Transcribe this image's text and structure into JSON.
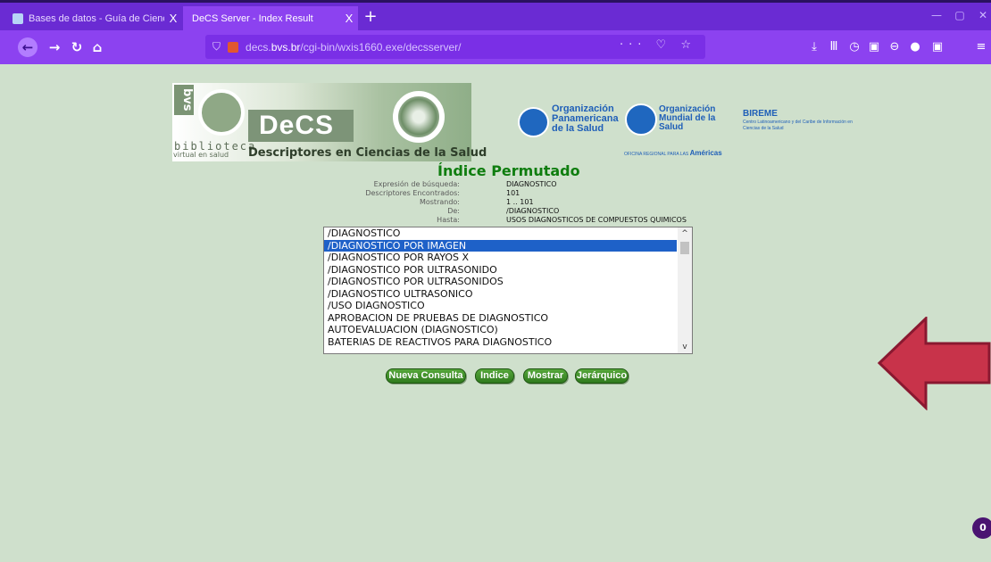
{
  "browser": {
    "tabs": [
      {
        "title": "Bases de datos - Guía de Cienc",
        "close": "X",
        "icon": "database-favicon-icon"
      },
      {
        "title": "DeCS Server - Index Result",
        "close": "X"
      }
    ],
    "new_tab": "+",
    "url_shield": "⛉",
    "url_host_pre": "decs.",
    "url_host_bold": "bvs.br",
    "url_path": "/cgi-bin/wxis1660.exe/decsserver/",
    "url_actions": "··· ♡ ☆",
    "icons": [
      "back-icon",
      "forward-icon",
      "reload-icon",
      "home-icon",
      "download-icon",
      "library-icon",
      "history-icon",
      "sidebar-icon",
      "account-icon",
      "notification-icon",
      "pocket-icon",
      "menu-icon"
    ],
    "colors": {
      "tabbar": "#6a2bd3",
      "toolbar": "#8c42f0"
    }
  },
  "header": {
    "bvs": "bvs",
    "decs": "DeCS",
    "biblioteca": "biblioteca",
    "virtual": "virtual en salud",
    "descriptores": "Descriptores en Ciencias de la Salud",
    "opas": "Organización Panamericana de la Salud",
    "oms": "Organización Mundial de la Salud",
    "oms_sub_small": "OFICINA REGIONAL PARA LAS",
    "oms_sub_big": "Américas",
    "bireme_title": "BIREME",
    "bireme_sub": "Centro Latinoamericano y del Caribe de Información en Ciencias de la Salud"
  },
  "index": {
    "title": "Índice Permutado",
    "rows": [
      {
        "key": "Expresión de búsqueda:",
        "value": "DIAGNOSTICO"
      },
      {
        "key": "Descriptores Encontrados:",
        "value": "101"
      },
      {
        "key": "Mostrando:",
        "value": "1 .. 101"
      },
      {
        "key": "De:",
        "value": "/DIAGNOSTICO"
      },
      {
        "key": "Hasta:",
        "value": "USOS DIAGNOSTICOS DE COMPUESTOS QUIMICOS"
      }
    ]
  },
  "list": {
    "items": [
      "/DIAGNOSTICO",
      "/DIAGNOSTICO POR IMAGEN",
      "/DIAGNOSTICO POR RAYOS X",
      "/DIAGNOSTICO POR ULTRASONIDO",
      "/DIAGNOSTICO POR ULTRASONIDOS",
      "/DIAGNOSTICO ULTRASONICO",
      "/USO DIAGNOSTICO",
      "APROBACION DE PRUEBAS DE DIAGNOSTICO",
      "AUTOEVALUACION (DIAGNOSTICO)",
      "BATERIAS DE REACTIVOS PARA DIAGNOSTICO"
    ],
    "selected_index": 1,
    "scroll_up": "^",
    "scroll_down": "v"
  },
  "buttons": {
    "nueva": "Nueva Consulta",
    "indice": "Indice",
    "mostrar": "Mostrar",
    "jerarquico": "Jerárquico"
  },
  "annotation": {
    "arrow_color": "#c8334a"
  },
  "badge": "0"
}
